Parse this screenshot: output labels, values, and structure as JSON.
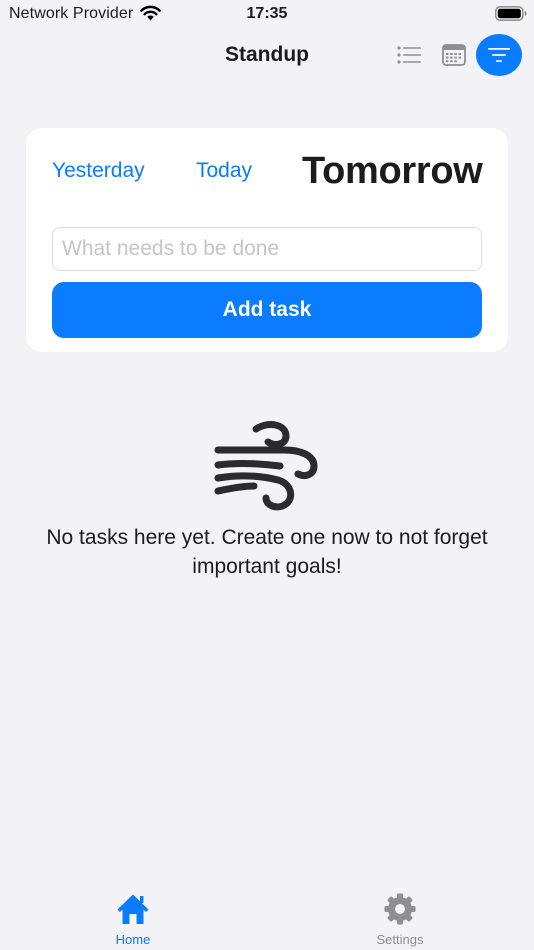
{
  "status_bar": {
    "carrier": "Network Provider",
    "time": "17:35"
  },
  "nav": {
    "title": "Standup",
    "actions": [
      "list-icon",
      "calendar-icon",
      "filter-icon"
    ]
  },
  "day_selector": {
    "yesterday": "Yesterday",
    "today": "Today",
    "tomorrow": "Tomorrow",
    "selected": "Tomorrow"
  },
  "task_form": {
    "input_value": "",
    "input_placeholder": "What needs to be done",
    "add_button_label": "Add task"
  },
  "empty_state": {
    "icon": "wind-icon",
    "message": "No tasks here yet. Create one now to not forget important goals!"
  },
  "tab_bar": {
    "items": [
      {
        "label": "Home",
        "icon": "home-icon",
        "active": true
      },
      {
        "label": "Settings",
        "icon": "gear-icon",
        "active": false
      }
    ]
  },
  "colors": {
    "accent": "#0a7cff",
    "background": "#f2f2f7",
    "card": "#ffffff",
    "inactive_tab": "#8e8e93"
  }
}
